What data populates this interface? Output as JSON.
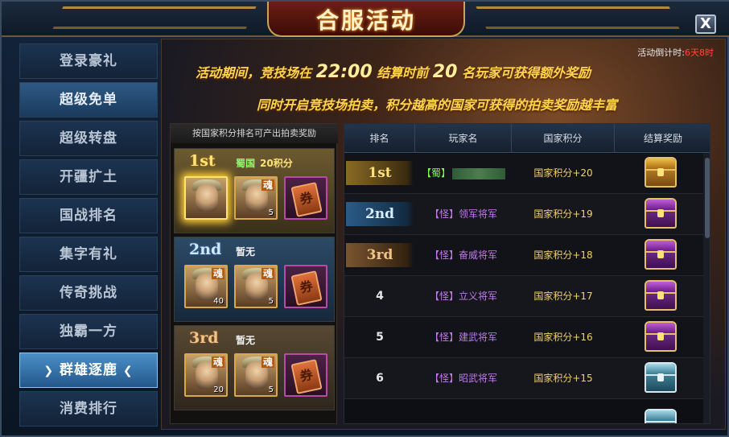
{
  "window": {
    "title": "合服活动",
    "close_label": "X"
  },
  "sidebar": {
    "items": [
      {
        "label": "登录豪礼"
      },
      {
        "label": "超级免单"
      },
      {
        "label": "超级转盘"
      },
      {
        "label": "开疆扩土"
      },
      {
        "label": "国战排名"
      },
      {
        "label": "集字有礼"
      },
      {
        "label": "传奇挑战"
      },
      {
        "label": "独霸一方"
      },
      {
        "label": "群雄逐鹿",
        "active": true
      },
      {
        "label": "消费排行"
      }
    ]
  },
  "main": {
    "countdown_label": "活动倒计时:",
    "countdown_value": "6天8时",
    "banner_line1_a": "活动期间，竞技场在",
    "banner_line1_time": "22:00",
    "banner_line1_b": "结算时前",
    "banner_line1_num": "20",
    "banner_line1_c": "名玩家可获得额外奖励",
    "banner_line2": "同时开启竞技场拍卖，积分越高的国家可获得的拍卖奖励越丰富"
  },
  "rewards": {
    "header": "按国家积分排名可产出拍卖奖励",
    "tiers": [
      {
        "rank": "1st",
        "country": "蜀国",
        "points": "20积分",
        "items": [
          {
            "soul": "",
            "qty": ""
          },
          {
            "soul": "魂",
            "qty": "5"
          },
          {
            "type": "ticket",
            "glyph": "券"
          }
        ]
      },
      {
        "rank": "2nd",
        "note": "暂无",
        "items": [
          {
            "soul": "魂",
            "qty": "40"
          },
          {
            "soul": "魂",
            "qty": "5"
          },
          {
            "type": "ticket",
            "glyph": "券"
          }
        ]
      },
      {
        "rank": "3rd",
        "note": "暂无",
        "items": [
          {
            "soul": "魂",
            "qty": "20"
          },
          {
            "soul": "魂",
            "qty": "5"
          },
          {
            "type": "ticket",
            "glyph": "券"
          }
        ]
      }
    ]
  },
  "ranking": {
    "headers": [
      "排名",
      "玩家名",
      "国家积分",
      "结算奖励"
    ],
    "rows": [
      {
        "rank": "1st",
        "name": "【蜀】",
        "score": "国家积分+20",
        "chest": "gold"
      },
      {
        "rank": "2nd",
        "name": "【怪】领军将军",
        "score": "国家积分+19",
        "chest": "purple"
      },
      {
        "rank": "3rd",
        "name": "【怪】奋威将军",
        "score": "国家积分+18",
        "chest": "purple"
      },
      {
        "rank": "4",
        "name": "【怪】立义将军",
        "score": "国家积分+17",
        "chest": "purple"
      },
      {
        "rank": "5",
        "name": "【怪】建武将军",
        "score": "国家积分+16",
        "chest": "purple"
      },
      {
        "rank": "6",
        "name": "【怪】昭武将军",
        "score": "国家积分+15",
        "chest": "silver"
      }
    ]
  },
  "colors": {
    "accent_gold": "#ffd54a",
    "countdown_red": "#ff4a3a",
    "monster_name": "#c07ae8",
    "shu_name": "#7cff4a",
    "active_tab": "#4a90c8"
  }
}
